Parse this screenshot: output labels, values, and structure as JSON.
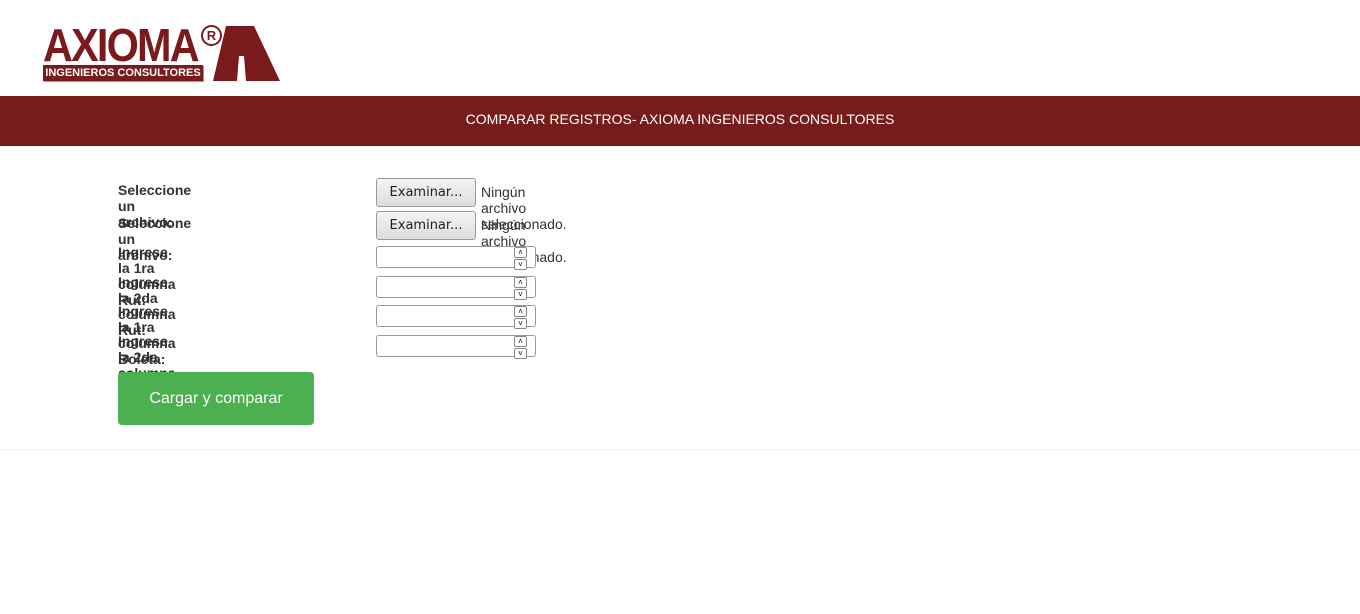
{
  "logo": {
    "word": "AXIOMA",
    "reg": "®",
    "tagline": "INGENIEROS CONSULTORES"
  },
  "header": {
    "title": "COMPARAR REGISTROS- AXIOMA INGENIEROS CONSULTORES"
  },
  "form": {
    "file1": {
      "label": "Seleccione un archivo:",
      "button": "Examinar...",
      "status": "Ningún archivo seleccionado."
    },
    "file2": {
      "label": "Seleccione un archivo:",
      "button": "Examinar...",
      "status": "Ningún archivo seleccionado."
    },
    "rut1": {
      "label": "Ingrese la 1ra columna Rut:",
      "value": ""
    },
    "rut2": {
      "label": "Ingrese la 2da columna Rut:",
      "value": ""
    },
    "boleta1": {
      "label": "Ingrese la 1ra columna Boleta:",
      "value": ""
    },
    "boleta2": {
      "label": "Ingrese la 2da columna Boleta:",
      "value": ""
    },
    "submit": "Cargar y comparar"
  }
}
